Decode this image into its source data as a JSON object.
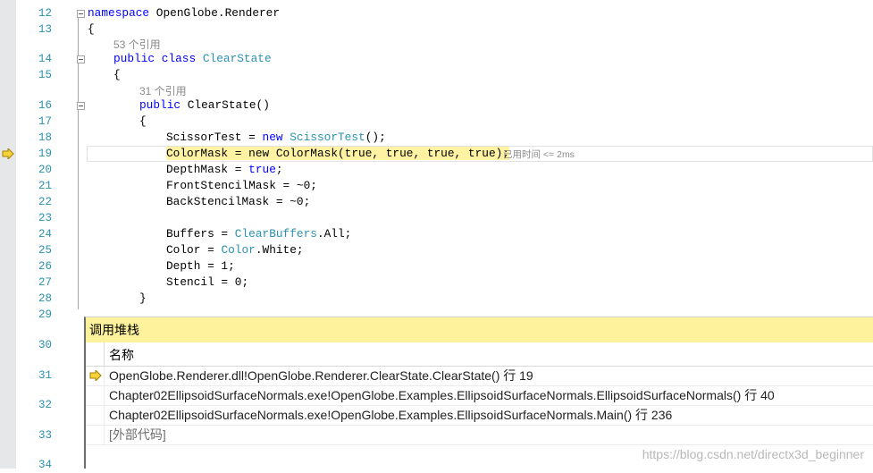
{
  "editor": {
    "line_numbers": [
      "12",
      "13",
      "14",
      "15",
      "16",
      "17",
      "18",
      "19",
      "20",
      "21",
      "22",
      "23",
      "24",
      "25",
      "26",
      "27",
      "28",
      "29",
      "30",
      "31",
      "32",
      "33",
      "34"
    ],
    "code": {
      "l12": {
        "kw": "namespace",
        "rest": " OpenGlobe.Renderer"
      },
      "l13": "{",
      "lens1": "53 个引用",
      "l14": {
        "kw1": "public",
        "kw2": "class",
        "type": "ClearState"
      },
      "l15": "{",
      "lens2": "31 个引用",
      "l16": {
        "kw": "public",
        "rest": " ClearState()"
      },
      "l17": "{",
      "l18": {
        "pre": "ScissorTest = ",
        "kw": "new",
        "type": "ScissorTest",
        "post": "();"
      },
      "l19": {
        "hl_var": "ColorMask",
        "mid": " = new ColorMask(true, true, true, true);"
      },
      "l20": {
        "pre": "DepthMask = ",
        "kw": "true",
        "post": ";"
      },
      "l21": "FrontStencilMask = ~0;",
      "l22": "BackStencilMask = ~0;",
      "l24": {
        "pre": "Buffers = ",
        "type": "ClearBuffers",
        "post": ".All;"
      },
      "l25": {
        "pre": "Color = ",
        "type": "Color",
        "post": ".White;"
      },
      "l26": "Depth = 1;",
      "l27": "Stencil = 0;",
      "l28": "}"
    },
    "perf_tip": "已用时间 <= 2ms"
  },
  "callstack": {
    "title": "调用堆栈",
    "column_name": "名称",
    "rows": [
      "OpenGlobe.Renderer.dll!OpenGlobe.Renderer.ClearState.ClearState() 行 19",
      "Chapter02EllipsoidSurfaceNormals.exe!OpenGlobe.Examples.EllipsoidSurfaceNormals.EllipsoidSurfaceNormals() 行 40",
      "Chapter02EllipsoidSurfaceNormals.exe!OpenGlobe.Examples.EllipsoidSurfaceNormals.Main() 行 236",
      "[外部代码]"
    ]
  },
  "watermark": "https://blog.csdn.net/directx3d_beginner",
  "colors": {
    "keyword": "#0000ff",
    "type": "#2b91af",
    "highlight": "#fff3a3",
    "panel_title": "#fff29d",
    "arrow": "#f0c020"
  },
  "icons": {
    "current_statement": "yellow-arrow-icon"
  }
}
